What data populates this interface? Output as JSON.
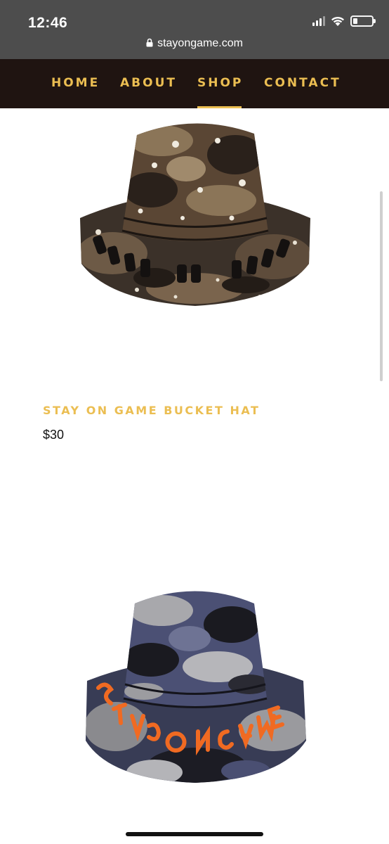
{
  "status_bar": {
    "time": "12:46",
    "icons": [
      "signal-icon",
      "wifi-icon",
      "battery-icon"
    ]
  },
  "browser": {
    "url": "stayongame.com"
  },
  "nav": {
    "items": [
      {
        "label": "HOME"
      },
      {
        "label": "ABOUT"
      },
      {
        "label": "SHOP",
        "active": true
      },
      {
        "label": "CONTACT"
      }
    ],
    "accent_color": "#ebbe52",
    "background_color": "#1f1411"
  },
  "products": [
    {
      "name": "STAY ON GAME BUCKET HAT",
      "price": "$30",
      "image": "brown-camo-bucket-hat"
    },
    {
      "image": "blue-camo-bucket-hat"
    }
  ]
}
